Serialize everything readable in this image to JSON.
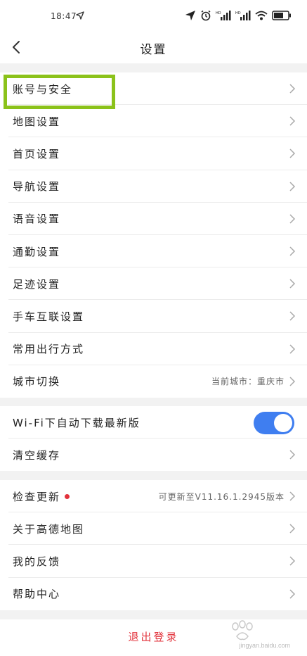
{
  "status_bar": {
    "time": "18:47"
  },
  "header": {
    "title": "设置"
  },
  "group1": [
    {
      "label": "账号与安全"
    },
    {
      "label": "地图设置"
    },
    {
      "label": "首页设置"
    },
    {
      "label": "导航设置"
    },
    {
      "label": "语音设置"
    },
    {
      "label": "通勤设置"
    },
    {
      "label": "足迹设置"
    },
    {
      "label": "手车互联设置"
    },
    {
      "label": "常用出行方式"
    },
    {
      "label": "城市切换",
      "hint": "当前城市：重庆市"
    }
  ],
  "group2": [
    {
      "label": "Wi-Fi下自动下载最新版",
      "toggle": true
    },
    {
      "label": "清空缓存"
    }
  ],
  "group3": [
    {
      "label": "检查更新",
      "hint": "可更新至V11.16.1.2945版本"
    },
    {
      "label": "关于高德地图"
    },
    {
      "label": "我的反馈"
    },
    {
      "label": "帮助中心"
    }
  ],
  "logout_label": "退出登录",
  "watermark": {
    "text": "jingyan.baidu.com"
  },
  "colors": {
    "accent_toggle": "#3f7ef0",
    "danger": "#e2323b",
    "highlight_box": "#8bc21a"
  },
  "icons": {
    "back": "chevron-left-icon",
    "row_arrow": "chevron-right-icon"
  }
}
